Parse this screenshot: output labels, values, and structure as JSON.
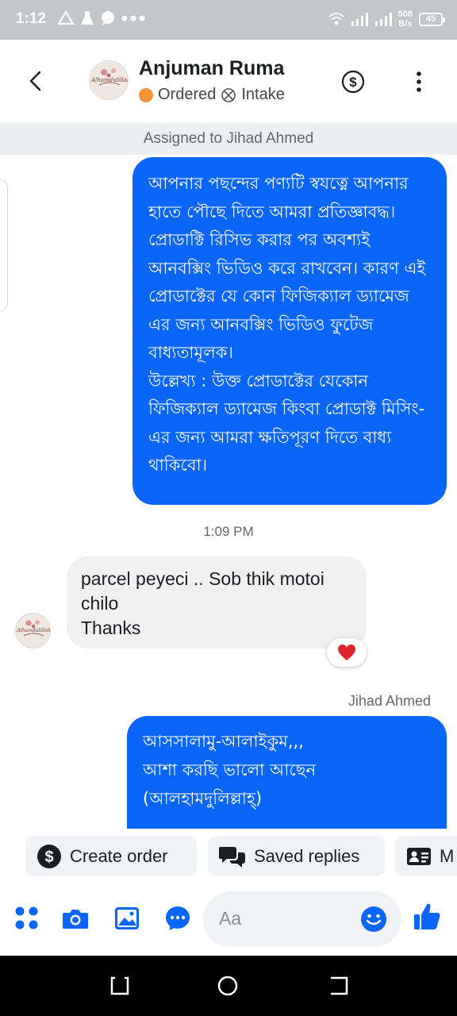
{
  "status_bar": {
    "time": "1:12",
    "net_speed_value": "508",
    "net_speed_unit": "B/s",
    "battery": "45"
  },
  "header": {
    "contact_name": "Anjuman Ruma",
    "status_label": "Ordered",
    "stage_label": "Intake",
    "avatar_text": "Alhamdulillah"
  },
  "assigned_banner": "Assigned to Jihad Ahmed",
  "messages": [
    {
      "direction": "outgoing",
      "text": "আপনার পছন্দের পণ্যটি স্বযত্নে আপনার হাতে পৌছে দিতে আমরা প্রতিজ্ঞাবদ্ধ। প্রোডাক্টি রিসিভ করার পর অবশ্যই আনবক্সিং ভিডিও করে রাখবেন। কারণ এই প্রোডাক্টের যে কোন ফিজিক্যাল ড্যামেজ এর জন্য আনবক্সিং ভিডিও ফুটেজ বাধ্যতামূলক।\nউল্লেখ্য : উক্ত প্রোডাক্টের যেকোন ফিজিক্যাল ড্যামেজ কিংবা প্রোডাক্ট মিসিং-এর জন্য আমরা ক্ষতিপূরণ দিতে বাধ্য থাকিবো।"
    },
    {
      "direction": "timestamp",
      "text": "1:09 PM"
    },
    {
      "direction": "incoming",
      "text": "parcel peyeci .. Sob thik motoi\nchilo\nThanks",
      "reaction": "heart"
    },
    {
      "direction": "sender",
      "text": "Jihad Ahmed"
    },
    {
      "direction": "outgoing",
      "text": "আসসালামু-আলাইকুম,,,\nআশা করছি ভালো আছেন\n(আলহামদুলিল্লাহ্)"
    }
  ],
  "quick_actions": [
    {
      "label": "Create order",
      "icon": "dollar-circle-icon"
    },
    {
      "label": "Saved replies",
      "icon": "chat-bubbles-icon"
    },
    {
      "label": "M",
      "icon": "contact-card-icon"
    }
  ],
  "composer": {
    "placeholder": "Aa"
  },
  "colors": {
    "accent": "#0a66fa",
    "incoming_bubble": "#f0f0f0",
    "status_bar": "#c4c5c8",
    "order_status_dot": "#f6943a"
  }
}
